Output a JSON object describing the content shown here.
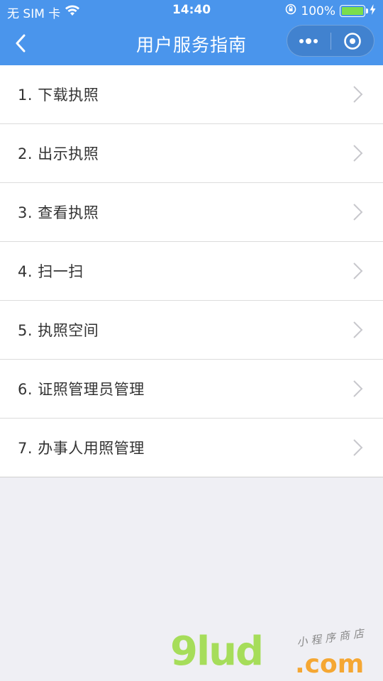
{
  "status_bar": {
    "carrier": "无 SIM 卡",
    "time": "14:40",
    "battery_percent": "100%",
    "battery_level": 1.0
  },
  "nav": {
    "title": "用户服务指南"
  },
  "list": {
    "items": [
      {
        "label": "1. 下载执照"
      },
      {
        "label": "2. 出示执照"
      },
      {
        "label": "3. 查看执照"
      },
      {
        "label": "4. 扫一扫"
      },
      {
        "label": "5. 执照空间"
      },
      {
        "label": "6. 证照管理员管理"
      },
      {
        "label": "7. 办事人用照管理"
      }
    ]
  },
  "watermark": {
    "main": "9lud",
    "domain": ".com",
    "subtitle": "小程序商店"
  },
  "colors": {
    "header": "#4a95ec",
    "background": "#efeff4",
    "text": "#333333",
    "chevron": "#c7c7cc"
  }
}
